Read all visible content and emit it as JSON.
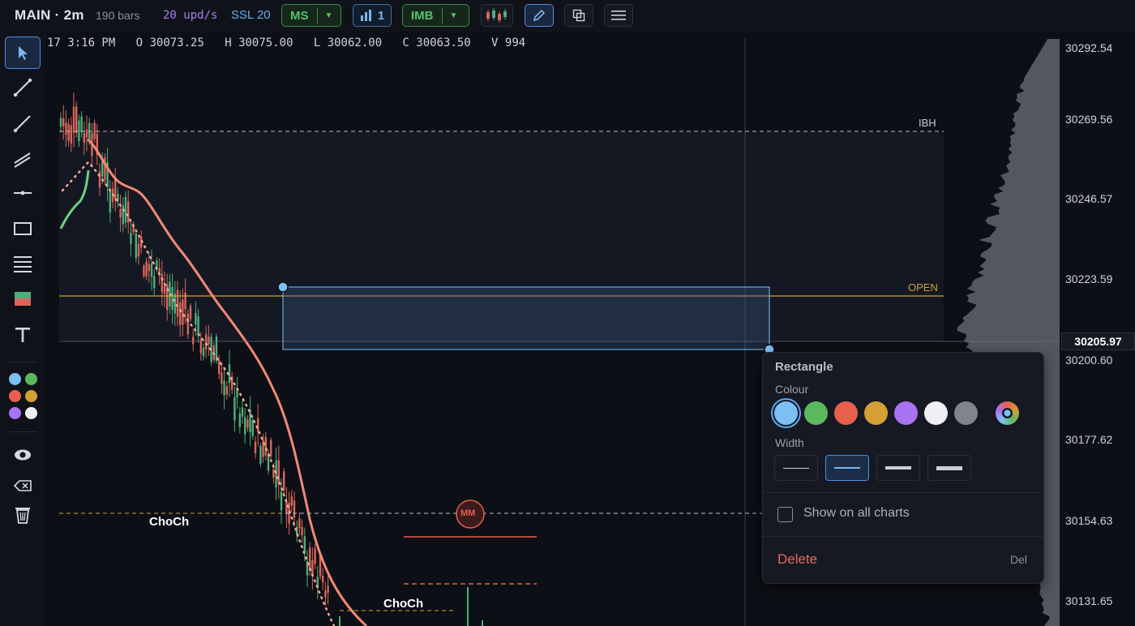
{
  "toolbar": {
    "title": "MAIN · 2m",
    "bars": "190 bars",
    "upd": "20 upd/s",
    "ssl": "SSL 20",
    "ms_label": "MS",
    "chart_count": "1",
    "imb_label": "IMB",
    "caret": "▼"
  },
  "ohlc": {
    "time": "17 3:16 PM",
    "open_label": "O",
    "open": "30073.25",
    "high_label": "H",
    "high": "30075.00",
    "low_label": "L",
    "low": "30062.00",
    "close_label": "C",
    "close": "30063.50",
    "vol_label": "V",
    "volume": "994"
  },
  "levels": {
    "ibh": "IBH",
    "open": "OPEN",
    "choch_1": "ChoCh",
    "choch_2": "ChoCh",
    "mm": "MM"
  },
  "price_axis": {
    "ticks": [
      "30292.54",
      "30269.56",
      "30246.57",
      "30223.59",
      "30200.60",
      "30177.62",
      "30154.63",
      "30131.65"
    ],
    "current": "30205.97"
  },
  "panel": {
    "title": "Rectangle",
    "colour_label": "Colour",
    "width_label": "Width",
    "show_all_label": "Show on all charts",
    "delete_label": "Delete",
    "delete_key": "Del",
    "swatch_colors": [
      "#7cc0f5",
      "#5cb85c",
      "#e8604c",
      "#d4a033",
      "#a873f0",
      "#eef0f4",
      "#80848c"
    ]
  },
  "colors": {
    "accent": "#4d8ee6",
    "open_level": "#d4a033",
    "ema": "#f08a74",
    "bull": "#4caf7a",
    "bear": "#d9665a"
  }
}
